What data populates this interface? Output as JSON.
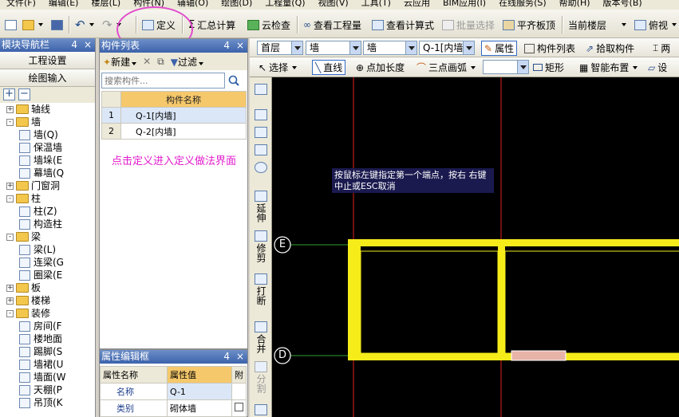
{
  "menu": [
    "文件(F)",
    "编辑(E)",
    "楼层(L)",
    "构件(N)",
    "辅轴(O)",
    "绘图(D)",
    "工程量(Q)",
    "视图(V)",
    "工具(T)",
    "云应用",
    "BIM应用(I)",
    "在线服务(S)",
    "帮助(H)",
    "版本号(B)"
  ],
  "toolbar": {
    "define": "定义",
    "sum_calc": "汇总计算",
    "cloud_check": "云检查",
    "view_quantity": "查看工程量",
    "view_formula": "查看计算式",
    "batch_select": "批量选择",
    "flush_top": "平齐板顶",
    "current_floor": "当前楼层",
    "view": "俯视"
  },
  "nav": {
    "title": "模块导航栏",
    "pin": "4",
    "close": "×",
    "btn_settings": "工程设置",
    "btn_drawing": "绘图输入",
    "tree": [
      {
        "label": "轴线",
        "level": 0,
        "toggle": "+"
      },
      {
        "label": "墙",
        "level": 0,
        "toggle": "-"
      },
      {
        "label": "墙(Q)",
        "level": 1
      },
      {
        "label": "保温墙",
        "level": 1
      },
      {
        "label": "墙垛(E",
        "level": 1
      },
      {
        "label": "幕墙(Q",
        "level": 1
      },
      {
        "label": "门窗洞",
        "level": 0,
        "toggle": "+"
      },
      {
        "label": "柱",
        "level": 0,
        "toggle": "-"
      },
      {
        "label": "柱(Z)",
        "level": 1
      },
      {
        "label": "构造柱",
        "level": 1
      },
      {
        "label": "梁",
        "level": 0,
        "toggle": "-"
      },
      {
        "label": "梁(L)",
        "level": 1
      },
      {
        "label": "连梁(G",
        "level": 1
      },
      {
        "label": "圈梁(E",
        "level": 1
      },
      {
        "label": "板",
        "level": 0,
        "toggle": "+"
      },
      {
        "label": "楼梯",
        "level": 0,
        "toggle": "+"
      },
      {
        "label": "装修",
        "level": 0,
        "toggle": "-"
      },
      {
        "label": "房间(F",
        "level": 1
      },
      {
        "label": "楼地面",
        "level": 1
      },
      {
        "label": "踢脚(S",
        "level": 1
      },
      {
        "label": "墙裙(U",
        "level": 1
      },
      {
        "label": "墙面(W",
        "level": 1
      },
      {
        "label": "天棚(P",
        "level": 1
      },
      {
        "label": "吊顶(K",
        "level": 1
      }
    ]
  },
  "components": {
    "title": "构件列表",
    "new": "新建",
    "filter": "过滤",
    "search_placeholder": "搜索构件...",
    "col_name": "构件名称",
    "rows": [
      {
        "num": "1",
        "name": "Q-1[内墙]"
      },
      {
        "num": "2",
        "name": "Q-2[内墙]"
      }
    ],
    "hint": "点击定义进入定义做法界面"
  },
  "props": {
    "title": "属性编辑框",
    "col_name": "属性名称",
    "col_value": "属性值",
    "col_extra": "附",
    "rows": [
      {
        "name": "名称",
        "value": "Q-1"
      },
      {
        "name": "类别",
        "value": "砌体墙"
      }
    ]
  },
  "row2": {
    "floor": "首层",
    "type1": "墙",
    "type2": "墙",
    "comp": "Q-1[内墙]",
    "attr": "属性",
    "comp_list": "构件列表",
    "pick": "拾取构件",
    "two": "两"
  },
  "row3": {
    "select": "选择",
    "line": "直线",
    "add_length": "点加长度",
    "three_arc": "三点画弧",
    "rect": "矩形",
    "smart": "智能布置",
    "settings": "设"
  },
  "vertical_tools": [
    "延伸",
    "修剪",
    "打断",
    "合并",
    "分割"
  ],
  "canvas": {
    "tooltip": "按鼠标左键指定第一个端点，按右 右键中止或ESC取消",
    "axis_e": "E",
    "axis_d": "D"
  }
}
